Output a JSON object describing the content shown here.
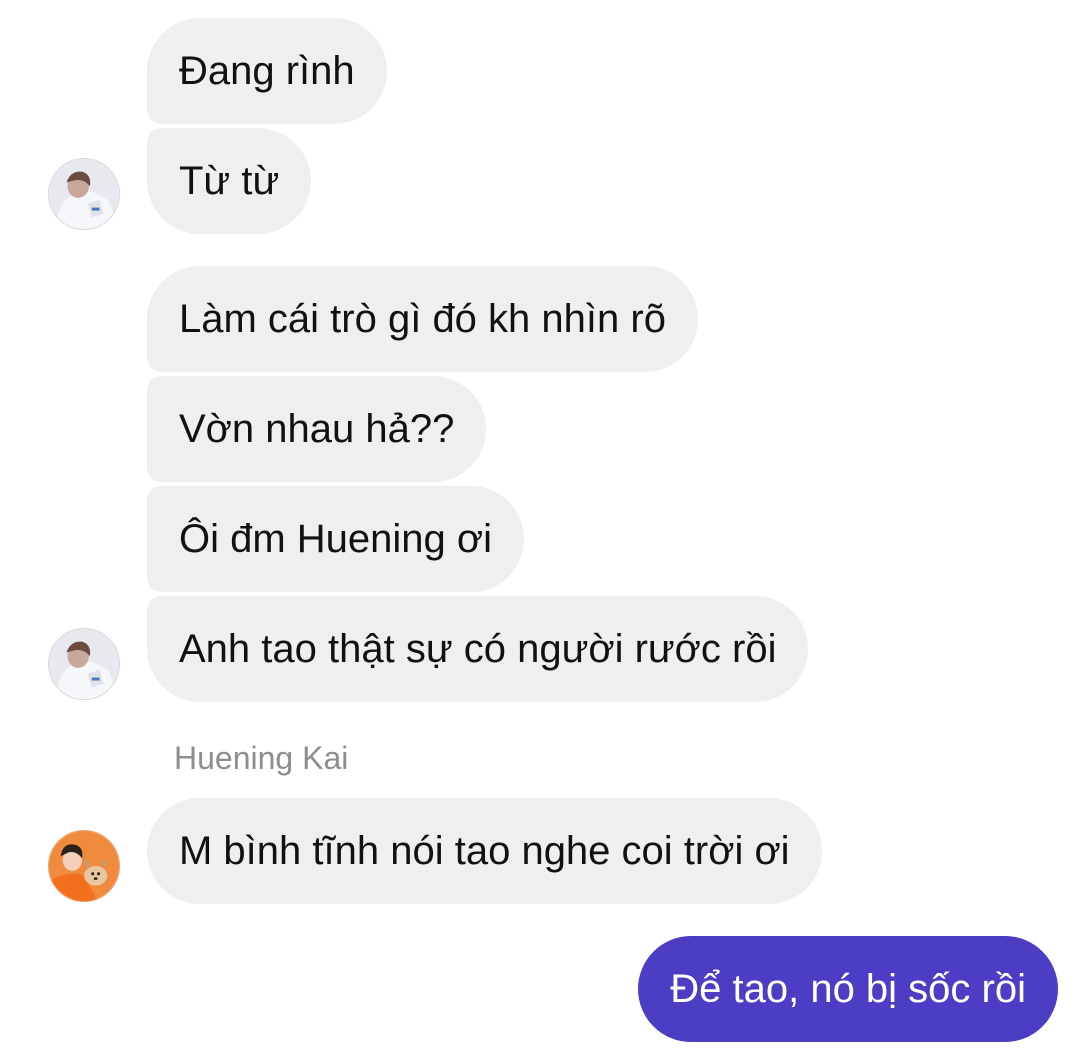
{
  "conversation": {
    "group_1": [
      {
        "text": "Đang rình"
      },
      {
        "text": "Từ từ"
      }
    ],
    "group_2": [
      {
        "text": "Làm cái trò gì đó kh nhìn rõ"
      },
      {
        "text": "Vờn nhau hả??"
      },
      {
        "text": "Ôi đm Huening ơi"
      },
      {
        "text": "Anh tao thật sự có người rước rồi"
      }
    ],
    "group_3": {
      "sender_name": "Huening Kai",
      "messages": [
        {
          "text": "M bình tĩnh nói tao nghe coi trời ơi"
        }
      ]
    },
    "outgoing": [
      {
        "text": "Để tao, nó bị sốc rồi"
      }
    ]
  },
  "avatars": {
    "contact_a": "white-hoodie-person-avatar",
    "contact_b": "person-with-dog-orange-avatar"
  },
  "colors": {
    "incoming_bubble": "#efefef",
    "outgoing_bubble": "#4c3ec4",
    "sender_name": "#8e8e8e"
  }
}
